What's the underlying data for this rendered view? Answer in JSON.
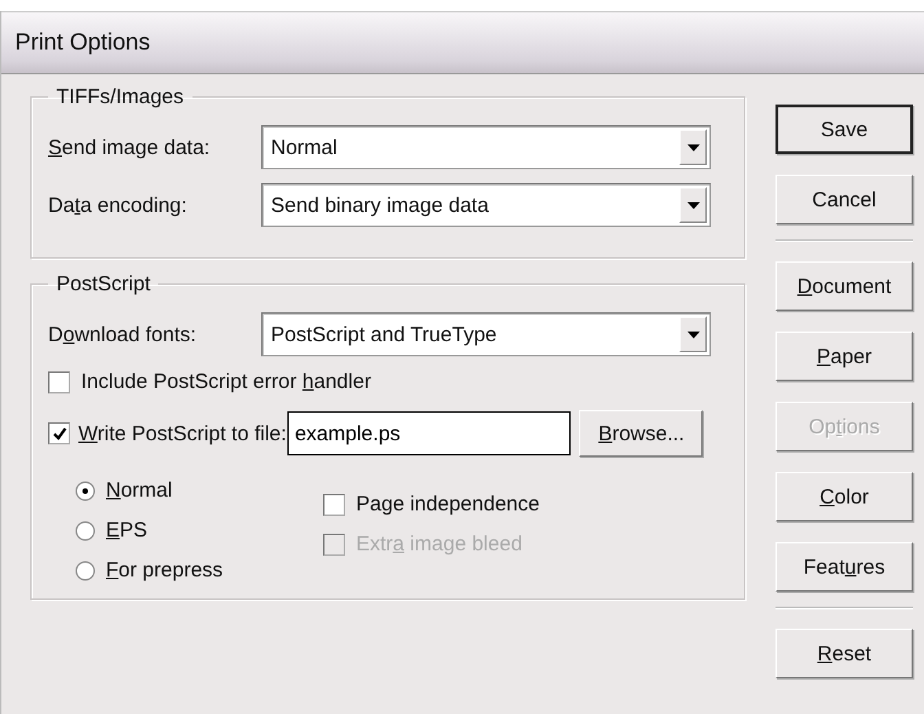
{
  "window": {
    "title": "Print Options"
  },
  "tiffs_images": {
    "title": "TIFFs/Images",
    "fields": [
      {
        "label": {
          "key": "S",
          "after": "end image data:"
        },
        "value": "Normal"
      },
      {
        "label": {
          "before": "Da",
          "key": "t",
          "after": "a encoding:"
        },
        "value": "Send binary image data"
      }
    ]
  },
  "postscript": {
    "title": "PostScript",
    "download_fonts": {
      "label": {
        "before": "D",
        "key": "o",
        "after": "wnload fonts:"
      },
      "value": "PostScript and TrueType"
    },
    "error_handler": {
      "label": {
        "before": "Include PostScript error ",
        "key": "h",
        "after": "andler"
      },
      "checked": false
    },
    "write_to_file": {
      "label": {
        "key": "W",
        "after": "rite PostScript to file:"
      },
      "checked": true,
      "value": "example.ps",
      "browse": {
        "key": "B",
        "after": "rowse..."
      }
    },
    "formats": [
      {
        "label": {
          "key": "N",
          "after": "ormal"
        },
        "selected": true
      },
      {
        "label": {
          "key": "E",
          "after": "PS"
        },
        "selected": false
      },
      {
        "label": {
          "key": "F",
          "after": "or prepress"
        },
        "selected": false
      }
    ],
    "page_independence": {
      "label": {
        "before": "Pa",
        "key": "g",
        "after": "e independence"
      },
      "checked": false,
      "disabled": false
    },
    "extra_image_bleed": {
      "label": {
        "before": "Extr",
        "key": "a",
        "after": " image bleed"
      },
      "checked": false,
      "disabled": true
    }
  },
  "buttons": [
    {
      "kind": "button",
      "label": {
        "after": "Save"
      },
      "default": true,
      "disabled": false
    },
    {
      "kind": "button",
      "label": {
        "after": "Cancel"
      },
      "default": false,
      "disabled": false
    },
    {
      "kind": "separator"
    },
    {
      "kind": "button",
      "label": {
        "key": "D",
        "after": "ocument"
      },
      "default": false,
      "disabled": false
    },
    {
      "kind": "button",
      "label": {
        "key": "P",
        "after": "aper"
      },
      "default": false,
      "disabled": false
    },
    {
      "kind": "button",
      "label": {
        "before": "Op",
        "key": "t",
        "after": "ions"
      },
      "default": false,
      "disabled": true
    },
    {
      "kind": "button",
      "label": {
        "key": "C",
        "after": "olor"
      },
      "default": false,
      "disabled": false
    },
    {
      "kind": "button",
      "label": {
        "before": "Feat",
        "key": "u",
        "after": "res"
      },
      "default": false,
      "disabled": false
    },
    {
      "kind": "separator"
    },
    {
      "kind": "button",
      "label": {
        "key": "R",
        "after": "eset"
      },
      "default": false,
      "disabled": false
    }
  ]
}
